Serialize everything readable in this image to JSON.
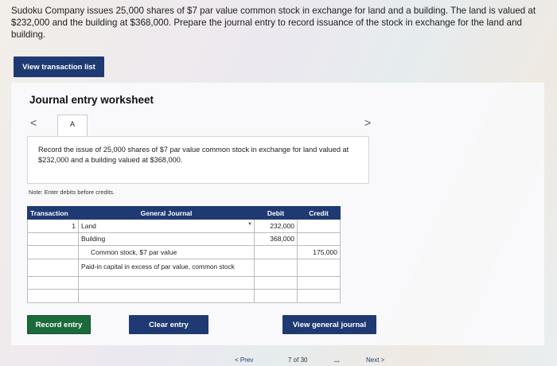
{
  "problem": {
    "text": "Sudoku Company issues 25,000 shares of $7 par value common stock in exchange for land and a building. The land is valued at $232,000 and the building at $368,000. Prepare the journal entry to record issuance of the stock in exchange for the land and building."
  },
  "buttons": {
    "view_transaction_list": "View transaction list",
    "record_entry": "Record entry",
    "clear_entry": "Clear entry",
    "view_general_journal": "View general journal"
  },
  "worksheet": {
    "title": "Journal entry worksheet",
    "prev_glyph": "<",
    "next_glyph": ">",
    "tab_label": "A",
    "description": "Record the issue of 25,000 shares of $7 par value common stock in exchange for land valued at $232,000 and a building valued at $368,000.",
    "note": "Note: Enter debits before credits."
  },
  "journal": {
    "headers": [
      "Transaction",
      "General Journal",
      "Debit",
      "Credit"
    ],
    "rows": [
      {
        "transaction": "1",
        "account": "Land",
        "indent": false,
        "debit": "232,000",
        "credit": ""
      },
      {
        "transaction": "",
        "account": "Building",
        "indent": false,
        "debit": "368,000",
        "credit": ""
      },
      {
        "transaction": "",
        "account": "Common stock, $7 par value",
        "indent": true,
        "debit": "",
        "credit": "175,000"
      },
      {
        "transaction": "",
        "account": "Paid-in capital in excess of par value, common stock",
        "indent": false,
        "debit": "",
        "credit": ""
      },
      {
        "transaction": "",
        "account": "",
        "indent": false,
        "debit": "",
        "credit": ""
      },
      {
        "transaction": "",
        "account": "",
        "indent": false,
        "debit": "",
        "credit": ""
      }
    ]
  },
  "footer": {
    "prev": "< Prev",
    "page": "7 of 30",
    "dots": "...",
    "next": "Next >"
  },
  "colors": {
    "primary": "#1f3a73",
    "record_green": "#1b6a3a"
  }
}
